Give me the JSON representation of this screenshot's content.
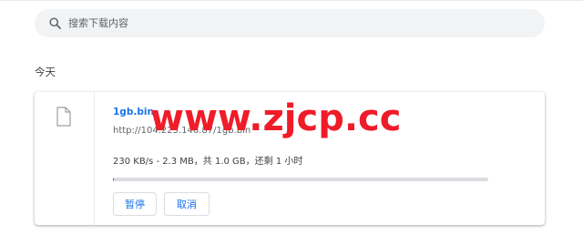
{
  "search": {
    "placeholder": "搜索下载内容",
    "icon": "search-icon"
  },
  "section": {
    "title": "今天"
  },
  "download": {
    "file_icon": "file-icon",
    "file_name": "1gb.bin",
    "url": "http://104.225.146.87/1gb.bin",
    "status": "230 KB/s - 2.3 MB，共 1.0 GB，还剩 1 小时",
    "progress_fraction": 0.0023,
    "pause_label": "暂停",
    "cancel_label": "取消"
  },
  "watermark": {
    "text": "www.zjcp.cc",
    "color": "#ef1c2a"
  },
  "colors": {
    "accent": "#1a73e8",
    "search_bg": "#f1f3f4",
    "progress_track": "#dadce0"
  }
}
